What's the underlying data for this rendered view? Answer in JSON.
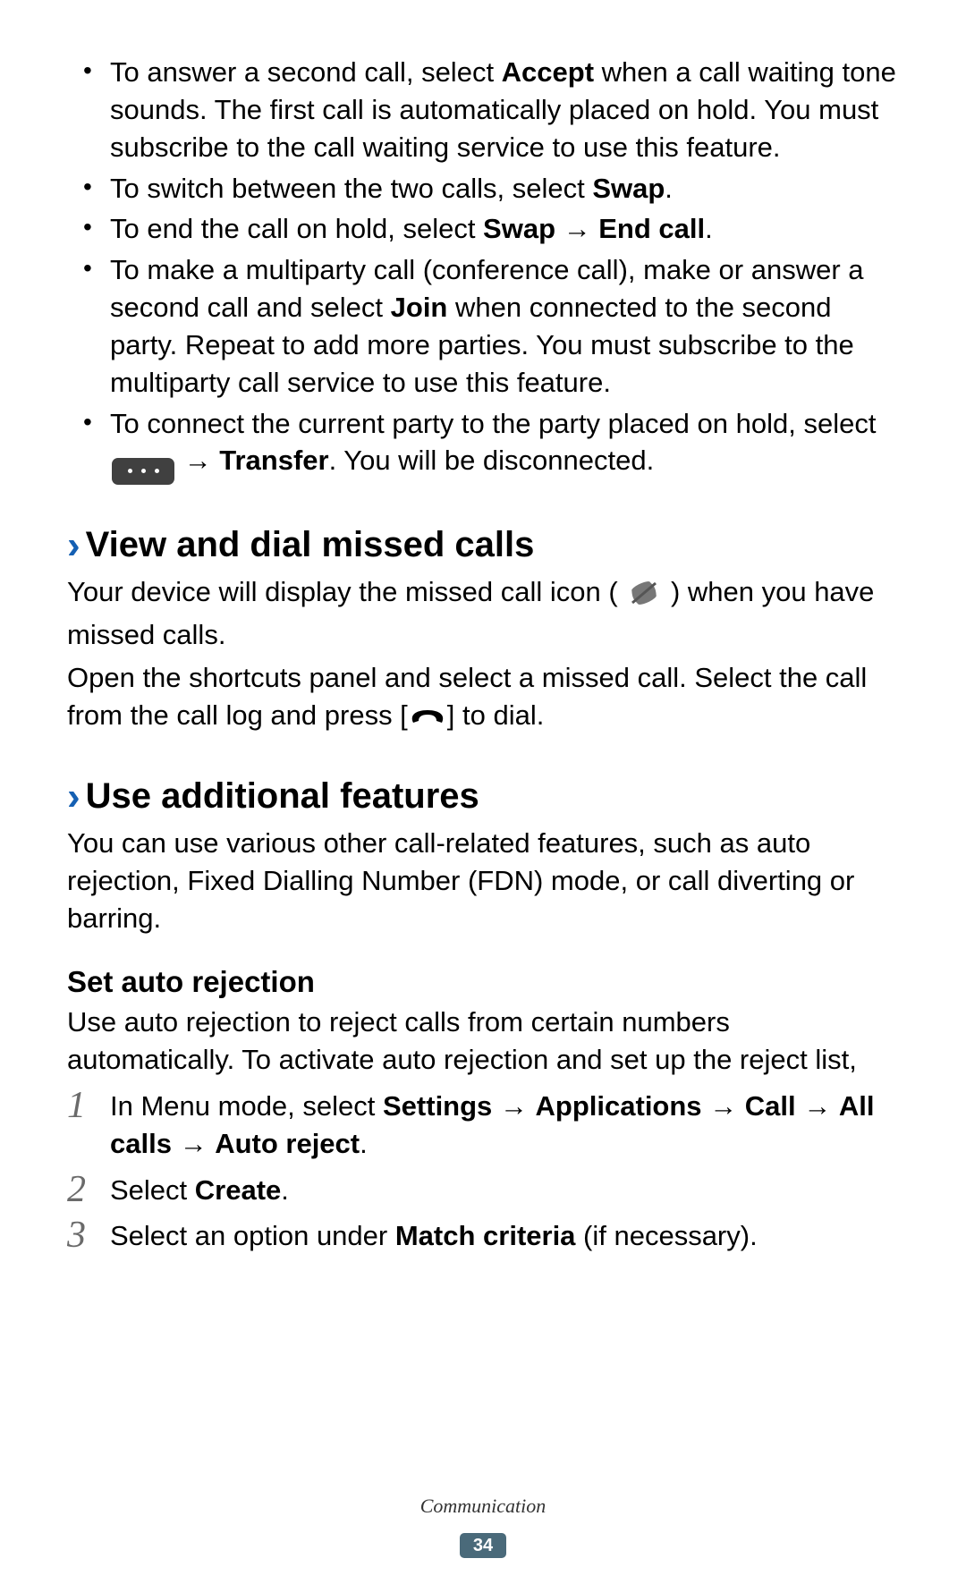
{
  "bullets": [
    {
      "pre": "To answer a second call, select ",
      "b1": "Accept",
      "post": " when a call waiting tone sounds. The first call is automatically placed on hold. You must subscribe to the call waiting service to use this feature."
    },
    {
      "pre": "To switch between the two calls, select ",
      "b1": "Swap",
      "post": "."
    },
    {
      "pre": "To end the call on hold, select ",
      "b1": "Swap",
      "mid": " → ",
      "b2": "End call",
      "post": "."
    },
    {
      "pre": "To make a multiparty call (conference call), make or answer a second call and select ",
      "b1": "Join",
      "post": " when connected to the second party. Repeat to add more parties. You must subscribe to the multiparty call service to use this feature."
    },
    {
      "pre": "To connect the current party to the party placed on hold, select ",
      "mid": " → ",
      "b2": "Transfer",
      "post": ". You will be disconnected."
    }
  ],
  "section1": {
    "title": "View and dial missed calls",
    "p1_pre": "Your device will display the missed call icon (",
    "p1_post": ") when you have missed calls.",
    "p2_pre": "Open the shortcuts panel and select a missed call. Select the call from the call log and press [",
    "p2_post": "] to dial."
  },
  "section2": {
    "title": "Use additional features",
    "p1": "You can use various other call-related features, such as auto rejection, Fixed Dialling Number (FDN) mode, or call diverting or barring.",
    "sub_title": "Set auto rejection",
    "sub_p": "Use auto rejection to reject calls from certain numbers automatically. To activate auto rejection and set up the reject list,",
    "steps": [
      {
        "pre": "In Menu mode, select ",
        "b1": "Settings",
        "a1": " → ",
        "b2": "Applications",
        "a2": " → ",
        "b3": "Call",
        "a3": " → ",
        "b4": "All calls",
        "a4": " → ",
        "b5": "Auto reject",
        "post": "."
      },
      {
        "pre": "Select ",
        "b1": "Create",
        "post": "."
      },
      {
        "pre": "Select an option under ",
        "b1": "Match criteria",
        "post": " (if necessary)."
      }
    ]
  },
  "footer": {
    "section": "Communication",
    "page": "34"
  }
}
